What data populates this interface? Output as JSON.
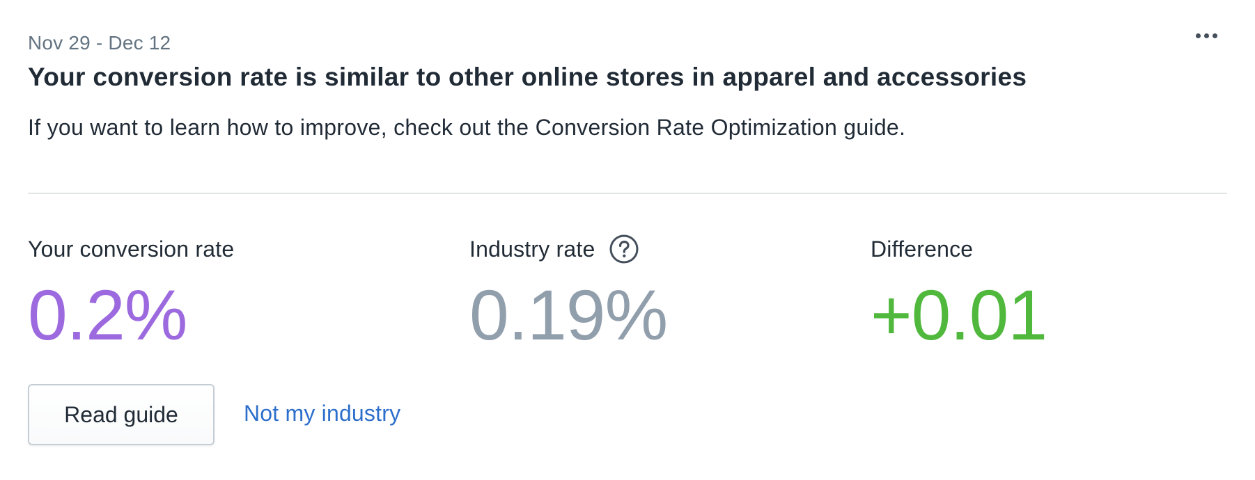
{
  "card": {
    "date_range": "Nov 29 - Dec 12",
    "headline": "Your conversion rate is similar to other online stores in apparel and accessories",
    "subtext": "If you want to learn how to improve, check out the Conversion Rate Optimization guide.",
    "more_icon": "ellipsis-horizontal-icon"
  },
  "metrics": [
    {
      "label": "Your conversion rate",
      "value": "0.2%"
    },
    {
      "label": "Industry rate",
      "value": "0.19%",
      "help_icon": "question-circle-icon"
    },
    {
      "label": "Difference",
      "value": "+0.01"
    }
  ],
  "actions": {
    "read_guide_label": "Read guide",
    "not_my_industry_label": "Not my industry"
  },
  "colors": {
    "your_rate": "#9c6ade",
    "industry_rate": "#919eab",
    "difference": "#50b83c",
    "link": "#2c6ecb"
  }
}
